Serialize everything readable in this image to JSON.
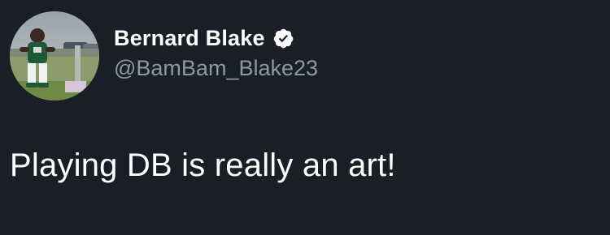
{
  "tweet": {
    "author": {
      "display_name": "Bernard Blake",
      "handle": "@BamBam_Blake23",
      "verified": true
    },
    "text": "Playing DB is really an art!"
  },
  "colors": {
    "background": "#1a1f27",
    "name": "#ffffff",
    "handle": "#8b98a5",
    "verified_badge": "#ffffff"
  },
  "icons": {
    "verified": "verified-badge-icon",
    "avatar": "profile-photo"
  }
}
